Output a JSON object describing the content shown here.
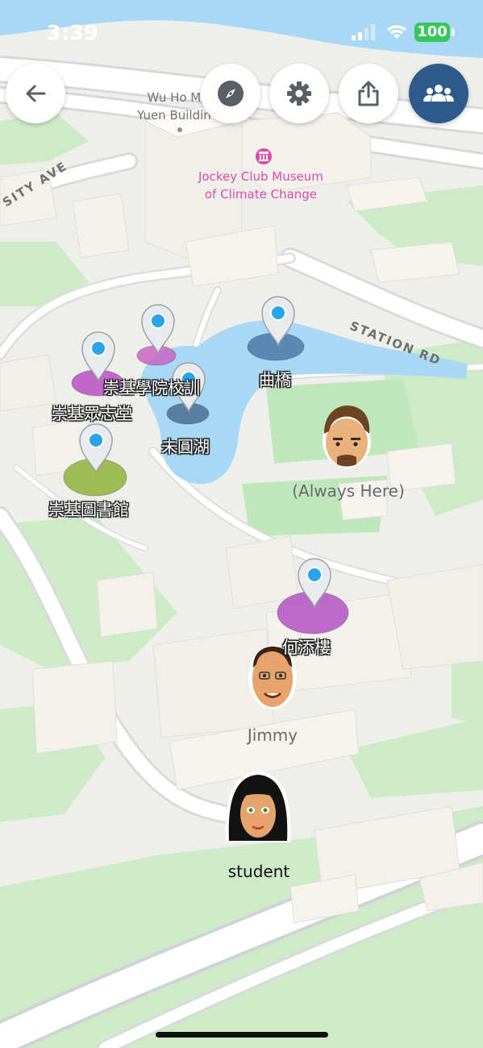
{
  "status_bar": {
    "time": "3:39",
    "battery": "100"
  },
  "map": {
    "building_labels": {
      "wu_ho_man_line1": "Wu Ho M",
      "wu_ho_man_line2": "Yuen Buildin",
      "museum_line1": "Jockey Club Museum",
      "museum_line2": "of Climate Change"
    },
    "road_labels": {
      "station_rd": "STATION RD",
      "university_ave": "SITY AVE"
    }
  },
  "pins": [
    {
      "label": "崇基學院校訓",
      "color": "#c964c5"
    },
    {
      "label": "曲橋",
      "color": "#4a7aa7"
    },
    {
      "label": "崇基眾志堂",
      "color": "#b84fc4"
    },
    {
      "label": "未圓湖",
      "color": "#4a6f95"
    },
    {
      "label": "崇基圖書館",
      "color": "#8fb23a"
    },
    {
      "label": "何添樓",
      "color": "#b352c4"
    }
  ],
  "people": [
    {
      "name": "(Always Here)"
    },
    {
      "name": "Jimmy"
    },
    {
      "name": "student"
    }
  ],
  "colors": {
    "accent": "#2d5a8b",
    "water": "#a9d8f4",
    "green": "#c9ebc4",
    "building": "#f3f1ec"
  },
  "icons": {
    "back": "arrow-left-icon",
    "compass": "compass-icon",
    "settings": "gear-icon",
    "share": "share-icon",
    "group": "group-icon"
  }
}
